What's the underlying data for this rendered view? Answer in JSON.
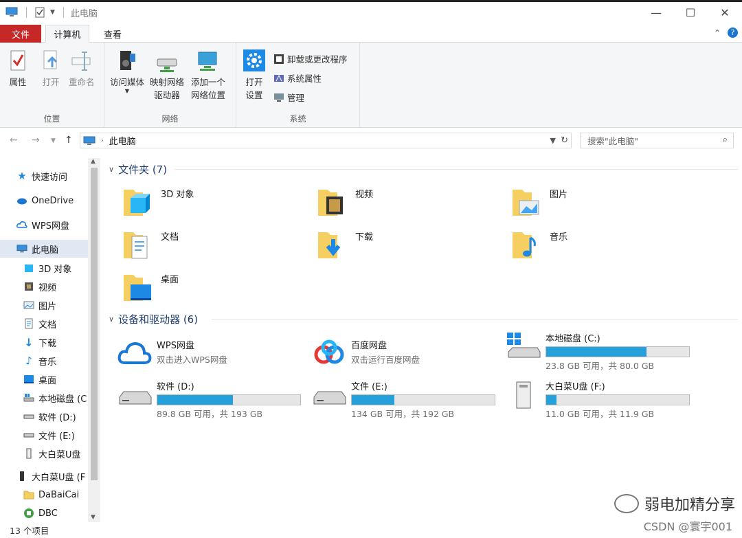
{
  "window": {
    "title": "此电脑",
    "minimize": "—",
    "maximize": "☐",
    "close": "✕"
  },
  "tabs": {
    "file": "文件",
    "computer": "计算机",
    "view": "查看"
  },
  "ribbon": {
    "location": {
      "name": "位置",
      "properties": "属性",
      "open": "打开",
      "rename": "重命名"
    },
    "network": {
      "name": "网络",
      "access_media": "访问媒体",
      "map_drive_1": "映射网络",
      "map_drive_2": "驱动器",
      "add_location_1": "添加一个",
      "add_location_2": "网络位置"
    },
    "system": {
      "name": "系统",
      "open_settings_1": "打开",
      "open_settings_2": "设置",
      "uninstall": "卸载或更改程序",
      "sys_props": "系统属性",
      "manage": "管理"
    }
  },
  "address": {
    "path": "此电脑",
    "search_placeholder": "搜索\"此电脑\""
  },
  "sidebar": {
    "items": [
      {
        "label": "快速访问"
      },
      {
        "label": "OneDrive"
      },
      {
        "label": "WPS网盘"
      },
      {
        "label": "此电脑"
      },
      {
        "label": "3D 对象"
      },
      {
        "label": "视频"
      },
      {
        "label": "图片"
      },
      {
        "label": "文档"
      },
      {
        "label": "下载"
      },
      {
        "label": "音乐"
      },
      {
        "label": "桌面"
      },
      {
        "label": "本地磁盘 (C"
      },
      {
        "label": "软件 (D:)"
      },
      {
        "label": "文件 (E:)"
      },
      {
        "label": "大白菜U盘"
      },
      {
        "label": "大白菜U盘 (F"
      },
      {
        "label": "DaBaiCai"
      },
      {
        "label": "DBC"
      }
    ]
  },
  "status": "13 个项目",
  "sections": {
    "folders_title": "文件夹 (7)",
    "drives_title": "设备和驱动器 (6)"
  },
  "folders": [
    {
      "name": "3D 对象"
    },
    {
      "name": "视频"
    },
    {
      "name": "图片"
    },
    {
      "name": "文档"
    },
    {
      "name": "下载"
    },
    {
      "name": "音乐"
    },
    {
      "name": "桌面"
    }
  ],
  "drives": [
    {
      "name": "WPS网盘",
      "sub": "双击进入WPS网盘"
    },
    {
      "name": "百度网盘",
      "sub": "双击运行百度网盘"
    },
    {
      "name": "本地磁盘 (C:)",
      "sub": "23.8 GB 可用，共 80.0 GB",
      "used": 0.7
    },
    {
      "name": "软件 (D:)",
      "sub": "89.8 GB 可用，共 193 GB",
      "used": 0.53
    },
    {
      "name": "文件 (E:)",
      "sub": "134 GB 可用，共 192 GB",
      "used": 0.3
    },
    {
      "name": "大白菜U盘 (F:)",
      "sub": "11.0 GB 可用，共 11.9 GB",
      "used": 0.07
    }
  ],
  "watermark": {
    "account": "弱电加精分享",
    "source": "CSDN @寰宇001"
  },
  "colors": {
    "accent": "#26a0da",
    "file_tab": "#c62828",
    "header": "#1e3c6e"
  }
}
